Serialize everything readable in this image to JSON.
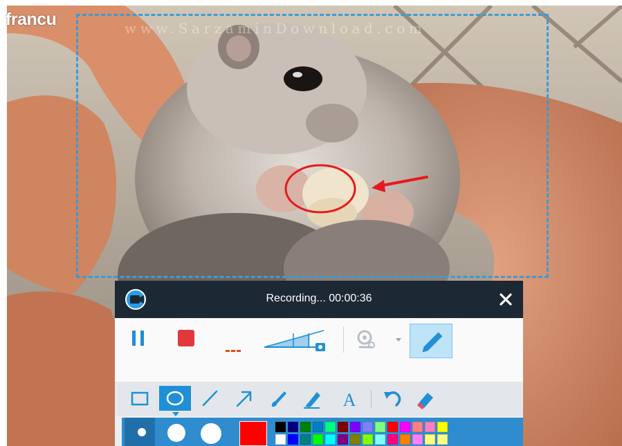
{
  "brand_text": "francu",
  "watermark_text": "www.SarzaminDownload.com",
  "recorder": {
    "title": "Recording... 00:00:36",
    "accent": "#1f8fd6",
    "titlebar_color": "#1c2834",
    "icons": {
      "app": "camera-icon",
      "close": "close-icon",
      "pause": "pause-icon",
      "stop": "stop-icon",
      "audio": "audio-level-icon",
      "volume": "volume-slider-icon",
      "webcam": "webcam-icon",
      "dropdown": "chevron-down-icon",
      "annotate": "pen-icon"
    },
    "volume_level": 0.8
  },
  "annotation_tools": [
    {
      "name": "rectangle-tool",
      "icon": "rectangle-icon"
    },
    {
      "name": "ellipse-tool",
      "icon": "ellipse-icon",
      "selected": true
    },
    {
      "name": "line-tool",
      "icon": "line-icon"
    },
    {
      "name": "arrow-tool",
      "icon": "arrow-icon"
    },
    {
      "name": "brush-tool",
      "icon": "brush-icon"
    },
    {
      "name": "highlighter-tool",
      "icon": "highlighter-icon"
    },
    {
      "name": "text-tool",
      "icon": "text-icon",
      "label": "A"
    },
    {
      "name": "undo-tool",
      "icon": "undo-icon"
    },
    {
      "name": "eraser-tool",
      "icon": "eraser-icon"
    }
  ],
  "pen_sizes": [
    "small",
    "medium",
    "large"
  ],
  "selected_pen_size": "small",
  "current_color": "#ff0000",
  "palette": [
    "#000000",
    "#000080",
    "#008000",
    "#0080c0",
    "#00ff80",
    "#800000",
    "#8000ff",
    "#8080ff",
    "#80ff80",
    "#ff0000",
    "#ff00ff",
    "#ff8080",
    "#ff80c0",
    "#ffff00",
    "#ffffff",
    "#0000ff",
    "#008080",
    "#00ff00",
    "#00ffff",
    "#800080",
    "#808000",
    "#80ff00",
    "#80ffff",
    "#ff0080",
    "#ff8000",
    "#ff80ff",
    "#ffff80",
    "#ffff80"
  ]
}
